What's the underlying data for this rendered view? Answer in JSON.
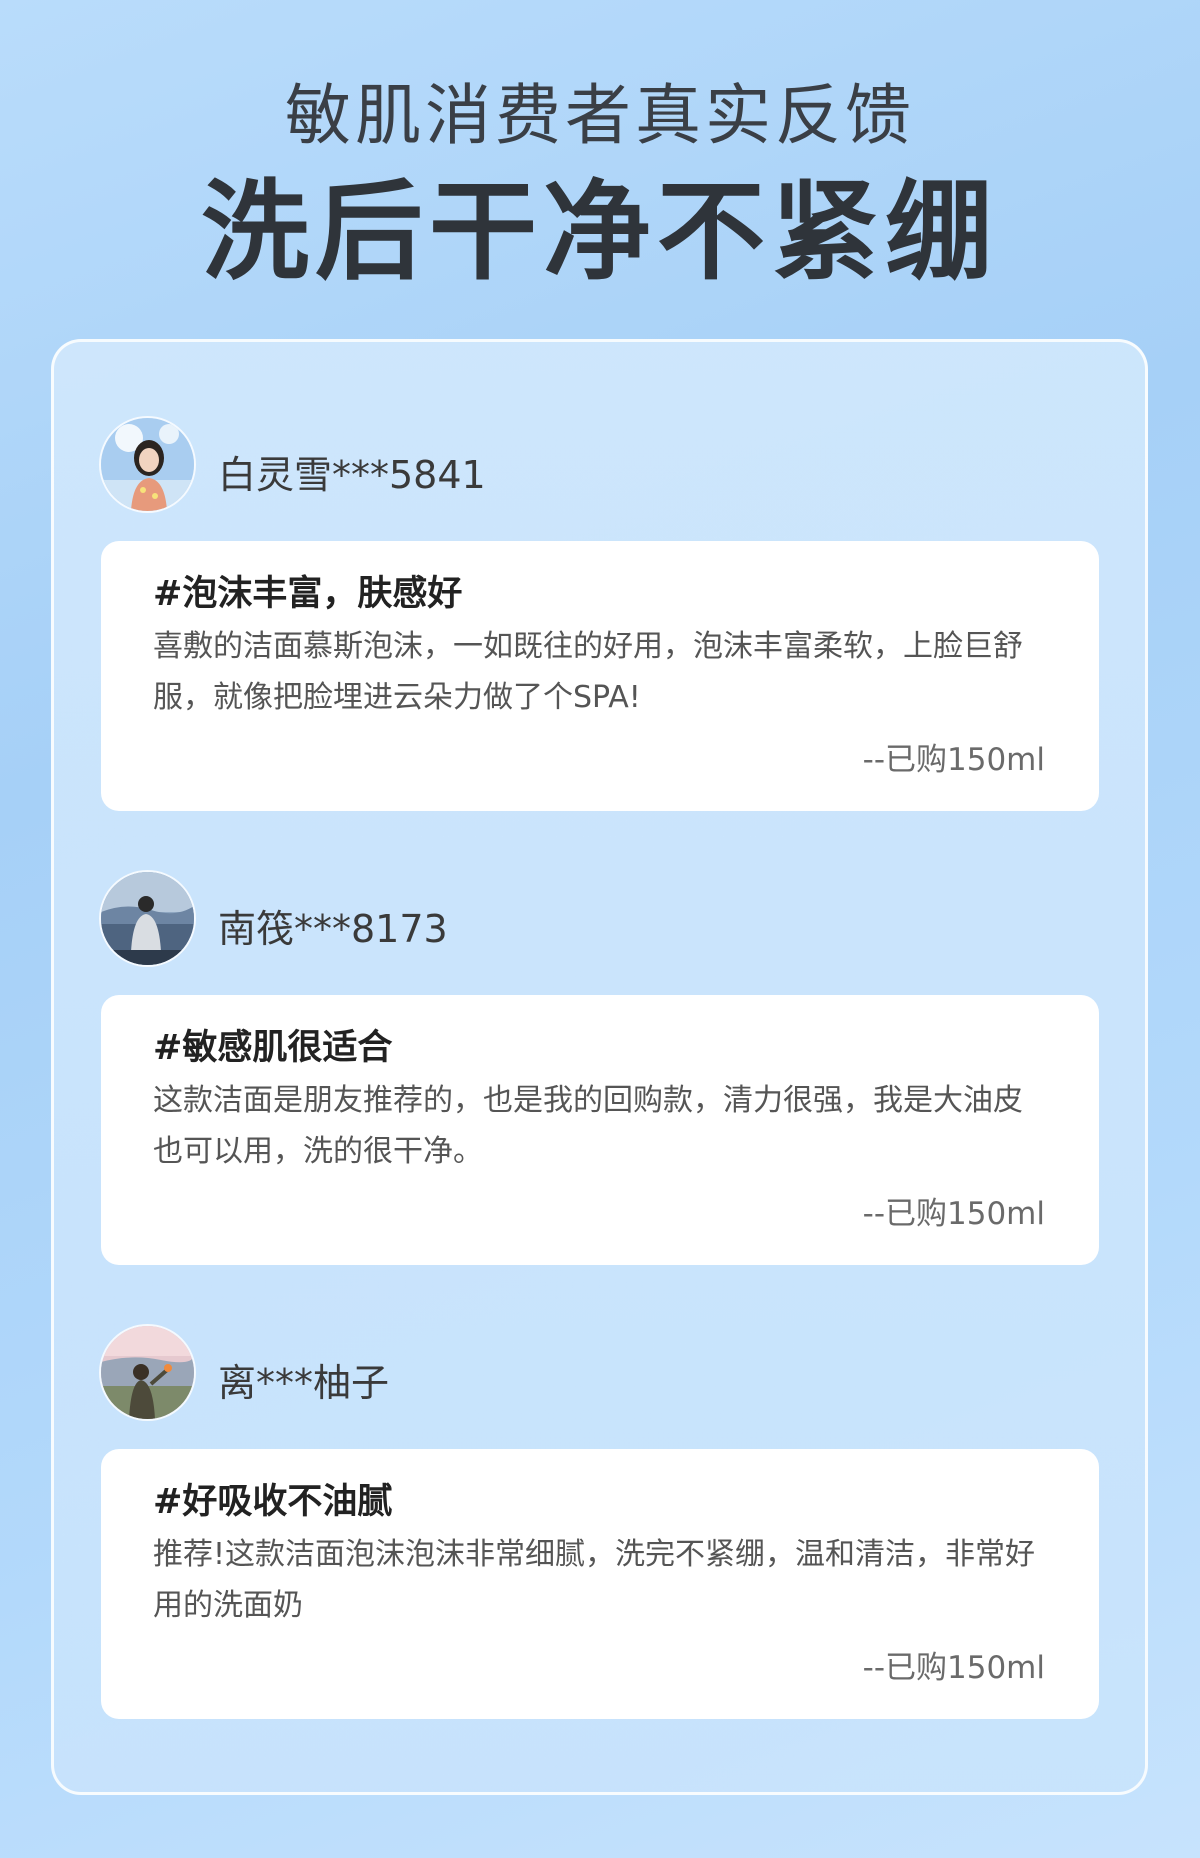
{
  "header": {
    "subtitle": "敏肌消费者真实反馈",
    "title": "洗后干净不紧绷"
  },
  "reviews": [
    {
      "user": "白灵雪***5841",
      "tag": "#泡沫丰富，肤感好",
      "text": "喜敷的洁面慕斯泡沫，一如既往的好用，泡沫丰富柔软，上脸巨舒服，就像把脸埋进云朵力做了个SPA!",
      "purchase": "--已购150ml"
    },
    {
      "user": "南筏***8173",
      "tag": "#敏感肌很适合",
      "text": "这款洁面是朋友推荐的，也是我的回购款，清力很强，我是大油皮也可以用，洗的很干净。",
      "purchase": "--已购150ml"
    },
    {
      "user": "离***柚子",
      "tag": "#好吸收不油腻",
      "text": "推荐!这款洁面泡沫泡沫非常细腻，洗完不紧绷，温和清洁，非常好用的洗面奶",
      "purchase": "--已购150ml"
    }
  ]
}
